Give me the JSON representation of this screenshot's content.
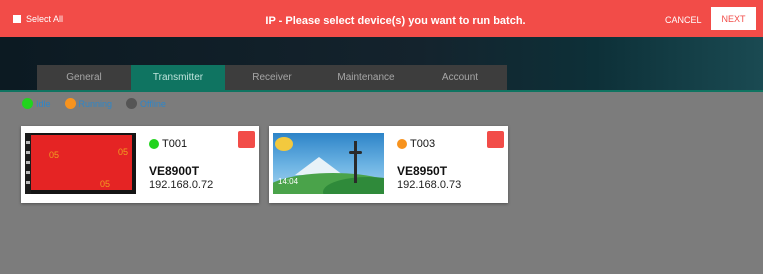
{
  "header": {
    "select_all": "Select All",
    "title": "IP - Please select device(s) you want to run batch.",
    "cancel": "CANCEL",
    "next": "NEXT"
  },
  "tabs": [
    {
      "label": "General",
      "active": false
    },
    {
      "label": "Transmitter",
      "active": true
    },
    {
      "label": "Receiver",
      "active": false
    },
    {
      "label": "Maintenance",
      "active": false
    },
    {
      "label": "Account",
      "active": false
    }
  ],
  "legend": [
    {
      "label": "Idle",
      "color": "#22d31e"
    },
    {
      "label": "Running",
      "color": "#f7931e"
    },
    {
      "label": "Offline",
      "color": "#555555"
    }
  ],
  "devices": [
    {
      "name": "T001",
      "status_color": "#22d31e",
      "model": "VE8900T",
      "ip": "192.168.0.72",
      "thumb_numbers": [
        "05",
        "05",
        "05"
      ],
      "selected": true
    },
    {
      "name": "T003",
      "status_color": "#f7931e",
      "model": "VE8950T",
      "ip": "192.168.0.73",
      "thumb_time": "14:04",
      "selected": true
    }
  ],
  "colors": {
    "accent": "#f24c48",
    "tab_active": "#0f7461"
  }
}
